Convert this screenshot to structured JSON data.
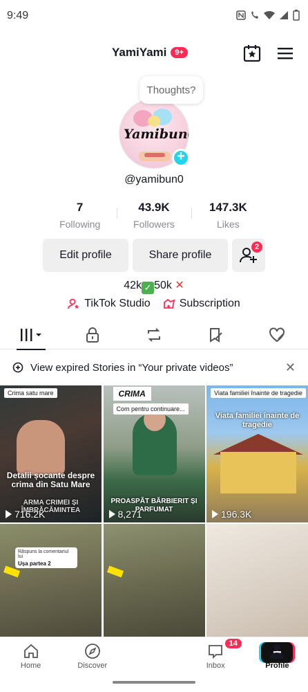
{
  "status_bar": {
    "time": "9:49"
  },
  "header": {
    "username": "YamiYami",
    "notif_badge": "9+"
  },
  "profile": {
    "thoughts_bubble": "Thoughts?",
    "avatar_text": "Yamibun0",
    "handle": "@yamibun0",
    "stats": [
      {
        "value": "7",
        "label": "Following"
      },
      {
        "value": "43.9K",
        "label": "Followers"
      },
      {
        "value": "147.3K",
        "label": "Likes"
      }
    ],
    "edit_label": "Edit profile",
    "share_label": "Share profile",
    "add_friends_badge": "2",
    "bio": {
      "part1": "42k",
      "part2": "50k"
    },
    "links": {
      "studio": "TikTok Studio",
      "subscription": "Subscription"
    }
  },
  "banner": {
    "text": "View expired Stories in “Your private videos”"
  },
  "videos": [
    {
      "tag": "Crima satu mare",
      "caption": "Detalii șocante despre crima din Satu Mare",
      "subcaption": "ARMA CRIMEI ȘI ÎMBRĂCĂMINTEA",
      "views": "716.2K"
    },
    {
      "tag": "CRIMA",
      "tag2": "Com pentru continuare...",
      "caption": "PROASPĂT BĂRBIERIT ȘI PARFUMAT",
      "views": "8,271"
    },
    {
      "tag": "Viata familiei înainte de tragedie",
      "caption": "Viata familiei înainte de tragedie",
      "views": "196.3K"
    },
    {
      "comment_head": "Răspuns la comentariul lui",
      "comment_body": "Ușa partea 2"
    },
    {},
    {}
  ],
  "bottom_nav": {
    "home": "Home",
    "discover": "Discover",
    "inbox": "Inbox",
    "inbox_badge": "14",
    "profile": "Profile"
  }
}
